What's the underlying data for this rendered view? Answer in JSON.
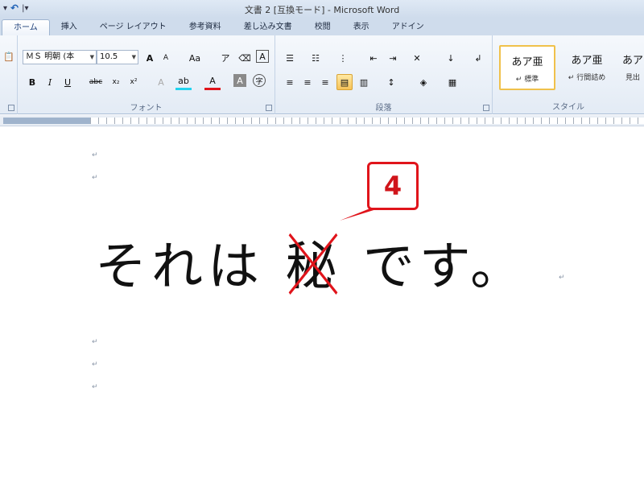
{
  "window": {
    "title": "文書 2 [互換モード] - Microsoft Word"
  },
  "qat": {
    "save_icon": "save-icon",
    "undo_icon": "undo-icon"
  },
  "tabs": [
    {
      "label": "ホーム",
      "active": true
    },
    {
      "label": "挿入"
    },
    {
      "label": "ページ レイアウト"
    },
    {
      "label": "参考資料"
    },
    {
      "label": "差し込み文書"
    },
    {
      "label": "校閲"
    },
    {
      "label": "表示"
    },
    {
      "label": "アドイン"
    }
  ],
  "ribbon": {
    "font": {
      "label": "フォント",
      "font_name": "ＭＳ 明朝 (本",
      "font_size": "10.5",
      "buttons": {
        "bold": "B",
        "italic": "I",
        "underline": "U",
        "strike": "abc",
        "subscript": "x₂",
        "superscript": "x²",
        "aa": "Aa",
        "grow": "A",
        "shrink": "A",
        "char_border": "A",
        "font_color": "A",
        "char_shade": "A"
      }
    },
    "paragraph": {
      "label": "段落"
    },
    "styles": {
      "label": "スタイル",
      "tiles": [
        {
          "sample": "あア亜",
          "name": "↵ 標準",
          "active": true
        },
        {
          "sample": "あア亜",
          "name": "↵ 行間詰め"
        },
        {
          "sample": "あア",
          "name": "見出"
        }
      ]
    }
  },
  "document": {
    "before": "それは",
    "struck": "秘",
    "after": "です。",
    "callout": "4",
    "para_marks": [
      "↵",
      "↵",
      "↵",
      "↵",
      "↵",
      "↵"
    ]
  },
  "colors": {
    "accent_red": "#e0141b",
    "ribbon": "#e3ebf5"
  }
}
